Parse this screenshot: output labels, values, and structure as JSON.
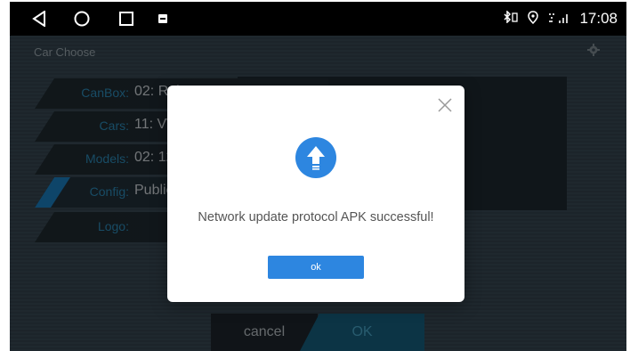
{
  "statusbar": {
    "time": "17:08",
    "indicators": [
      "bluetooth-icon",
      "vibrate-icon",
      "location-icon",
      "signal-icon"
    ]
  },
  "nav": [
    "back-icon",
    "home-icon",
    "recents-icon",
    "app-icon"
  ],
  "app": {
    "title": "Car Choose",
    "rows": [
      {
        "label": "CanBox:",
        "value": "02: Raise"
      },
      {
        "label": "Cars:",
        "value": "11: VW"
      },
      {
        "label": "Models:",
        "value": "02: 12 P"
      },
      {
        "label": "Config:",
        "value": "Public"
      },
      {
        "label": "Logo:",
        "value": ""
      }
    ],
    "cancel_label": "cancel",
    "ok_label": "OK"
  },
  "dialog": {
    "message": "Network update protocol APK successful!",
    "ok_label": "ok",
    "accent": "#2d86e0"
  },
  "colors": {
    "label_blue": "#2c8ab8",
    "active_stripe": "#1b7fbf"
  }
}
